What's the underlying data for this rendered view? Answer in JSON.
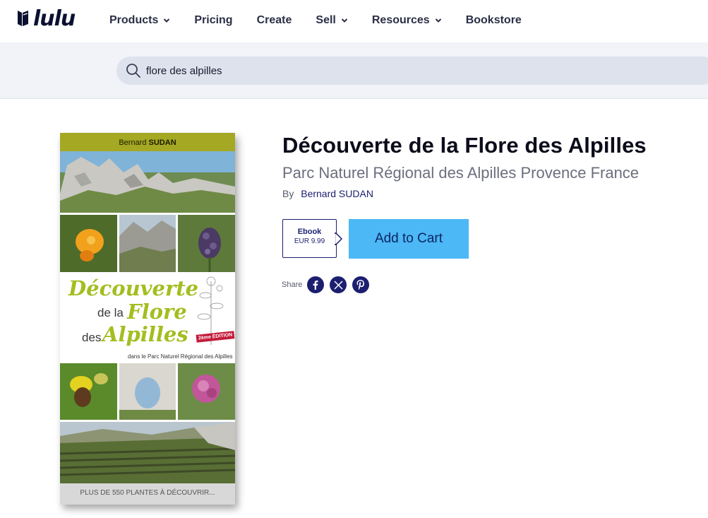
{
  "brand": {
    "logo_text": "lulu"
  },
  "nav": {
    "items": [
      {
        "label": "Products",
        "has_dropdown": true
      },
      {
        "label": "Pricing",
        "has_dropdown": false
      },
      {
        "label": "Create",
        "has_dropdown": false
      },
      {
        "label": "Sell",
        "has_dropdown": true
      },
      {
        "label": "Resources",
        "has_dropdown": true
      },
      {
        "label": "Bookstore",
        "has_dropdown": false
      }
    ]
  },
  "search": {
    "value": "flore des alpilles",
    "icon": "search-icon"
  },
  "cover": {
    "author_first": "Bernard",
    "author_last": "SUDAN",
    "title_line1": "Découverte",
    "title_de_la": "de la",
    "title_flore": "Flore",
    "title_des": "des",
    "title_alpilles": "Alpilles",
    "edition": "2ème ÉDITION",
    "subtitle": "dans le Parc Naturel Régional des Alpilles",
    "bottom_text": "PLUS DE 550 PLANTES À DÉCOUVRIR..."
  },
  "product": {
    "title": "Découverte de la Flore des Alpilles",
    "subtitle": "Parc Naturel Régional des Alpilles Provence France",
    "by_label": "By",
    "author": "Bernard SUDAN",
    "format": {
      "type": "Ebook",
      "price": "EUR 9.99"
    },
    "add_to_cart": "Add to Cart"
  },
  "share": {
    "label": "Share",
    "networks": [
      "facebook-icon",
      "x-icon",
      "pinterest-icon"
    ]
  },
  "colors": {
    "accent": "#4cb8f5",
    "navy": "#1c1f70",
    "search_band": "#f1f3f8",
    "cover_green": "#a2be1f"
  }
}
